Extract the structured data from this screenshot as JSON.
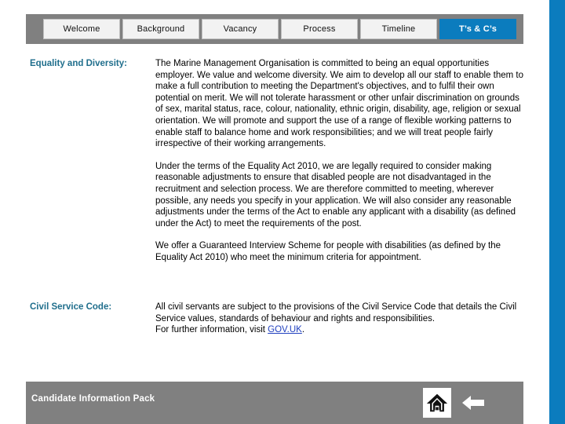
{
  "theme": {
    "accent_blue": "#0B7CBE",
    "bar_gray": "#808080",
    "heading_teal": "#1F6E8C",
    "link_blue": "#1F3FBF",
    "tab_face": "#F2F2F2"
  },
  "tabs": [
    {
      "label": "Welcome",
      "active": false
    },
    {
      "label": "Background",
      "active": false
    },
    {
      "label": "Vacancy",
      "active": false
    },
    {
      "label": "Process",
      "active": false
    },
    {
      "label": "Timeline",
      "active": false
    },
    {
      "label": "T’s & C’s",
      "active": true
    }
  ],
  "sections": [
    {
      "heading": "Equality and Diversity:",
      "paragraphs": [
        "The Marine Management Organisation is committed to being an equal opportunities employer. We value and welcome diversity. We aim to develop all our staff to enable them to make a full contribution to meeting the Department's objectives, and to fulfil their own potential on merit. We will not tolerate harassment or other unfair discrimination on grounds of sex, marital status, race, colour, nationality, ethnic origin, disability, age, religion or sexual orientation. We will promote and support the use of a range of flexible working patterns to enable staff to balance home and work responsibilities; and we will treat people fairly irrespective of their working arrangements.",
        "Under the terms of the Equality Act 2010, we are legally required to consider making reasonable adjustments to ensure that disabled people are not disadvantaged in the recruitment and selection process. We are therefore committed to meeting, wherever possible, any needs you specify in your application. We will also consider any reasonable adjustments under the terms of the Act to enable any applicant with a disability (as defined under the Act) to meet the requirements of the post.",
        "We offer a Guaranteed Interview Scheme for people with disabilities (as defined by the Equality Act 2010) who meet the minimum criteria for appointment."
      ]
    },
    {
      "heading": "Civil Service Code:",
      "paragraph_part1": "All civil servants are subject to the provisions of the Civil Service Code that details the Civil Service values, standards of behaviour and rights and responsibilities.",
      "paragraph_part2": "For further information, visit ",
      "link_text": "GOV.UK",
      "paragraph_part3": "."
    }
  ],
  "footer": {
    "title": "Candidate Information Pack",
    "home_icon": "home-icon",
    "back_icon": "back-arrow-icon"
  }
}
